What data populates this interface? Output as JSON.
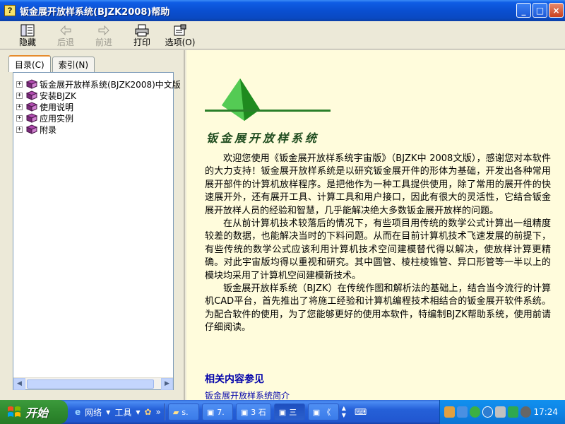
{
  "window": {
    "title": "钣金展开放样系统(BJZK2008)帮助",
    "buttons": [
      "_",
      "□",
      "×"
    ]
  },
  "toolbar": {
    "hide_label": "隐藏",
    "back_label": "后退",
    "forward_label": "前进",
    "print_label": "打印",
    "options_label": "选项(O)"
  },
  "tabs": {
    "contents_label": "目录(C)",
    "index_label": "索引(N)"
  },
  "tree": {
    "items": [
      {
        "label": "钣金展开放样系统(BJZK2008)中文版"
      },
      {
        "label": "安装BJZK"
      },
      {
        "label": "使用说明"
      },
      {
        "label": "应用实例"
      },
      {
        "label": "附录"
      }
    ]
  },
  "content": {
    "logo_text": "钣金展开放样系统",
    "paragraphs": [
      "欢迎您使用《钣金展开放样系统宇宙版》（BJZK中 2008文版），感谢您对本软件的大力支持！钣金展开放样系统是以研究钣金展开件的形体为基础，开发出各种常用展开部件的计算机放样程序。是把他作为一种工具提供使用，除了常用的展开件的快速展开外，还有展开工具、计算工具和用户接口，因此有很大的灵活性，它结合钣金展开放样人员的经验和智慧，几乎能解决绝大多数钣金展开放样的问题。",
      "在从前计算机技术较落后的情况下，有些项目用传统的数学公式计算出一组精度较差的数据，也能解决当时的下料问题。从而在目前计算机技术飞速发展的前提下，有些传统的数学公式应该利用计算机技术空间建模替代得以解决，使放样计算更精确。对此宇宙版均得以重视和研究。其中圆管、棱柱棱锥管、异口形管等一半以上的模块均采用了计算机空间建模新技术。",
      "钣金展开放样系统（BJZK）在传统作图和解析法的基础上，结合当今流行的计算机CAD平台，首先推出了将施工经验和计算机编程技术相结合的钣金展开软件系统。为配合软件的使用，为了您能够更好的使用本软件，特编制BJZK帮助系统，使用前请仔细阅读。"
    ],
    "related_heading": "相关内容参见",
    "related_item": "钣金展开放样系统简介"
  },
  "taskbar": {
    "start_label": "开始",
    "quick_items": [
      "网络",
      "工具"
    ],
    "tasks": [
      "s.",
      "7.",
      "3 石",
      "三",
      "《"
    ],
    "clock": "17:24"
  },
  "colors": {
    "title_bar": "#0A4FD1",
    "content_bg": "#FFFCDC",
    "link": "#0000AA",
    "logo_green": "#2A7F2A",
    "start_green": "#2F8A2F"
  }
}
